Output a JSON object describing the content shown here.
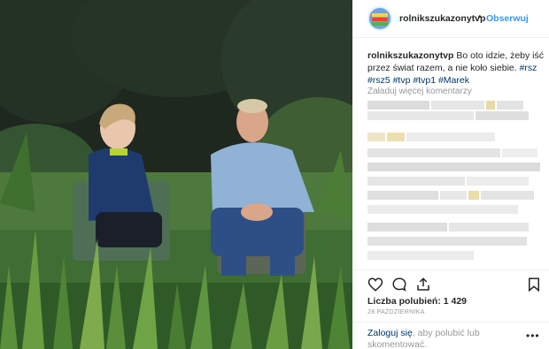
{
  "post": {
    "username": "rolnikszukazonytvp",
    "separator": "•",
    "follow_label": "Obserwuj",
    "avatar_text": "ROLNIK SZUKA ŻONY",
    "caption_user": "rolnikszukazonytvp",
    "caption_text": "Bo oto idzie, żeby iść przez świat razem, a nie koło siebie.",
    "caption_tags": "#rsz #rsz5 #tvp #tvp1 #Marek",
    "load_more": "Załaduj więcej komentarzy",
    "likes": "Liczba polubień: 1 429",
    "date": "28 PAŹDZIERNIKA",
    "login_link": "Zaloguj się",
    "login_text": ", aby polubić lub skomentować.",
    "more_icon": "•••"
  },
  "icons": [
    "heart-icon",
    "comment-icon",
    "share-icon",
    "bookmark-icon"
  ],
  "colors": {
    "link": "#3897f0",
    "hashtag": "#003569",
    "muted": "#999999"
  }
}
